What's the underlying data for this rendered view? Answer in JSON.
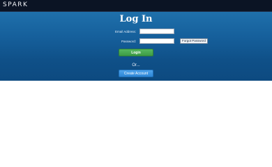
{
  "header": {
    "logo_text": "SPARK"
  },
  "login": {
    "title": "Log In",
    "email_label": "Email Address:",
    "email_value": "",
    "password_label": "Password:",
    "password_value": "",
    "forgot_label": "Forgot Password",
    "login_label": "Login",
    "or_text": "Or...",
    "create_label": "Create Account"
  },
  "colors": {
    "topbar": "#0b1424",
    "panel_top": "#1f70ab",
    "panel_bottom": "#0d4a80",
    "login_button": "#3d9b46",
    "create_button": "#2d86d6"
  }
}
